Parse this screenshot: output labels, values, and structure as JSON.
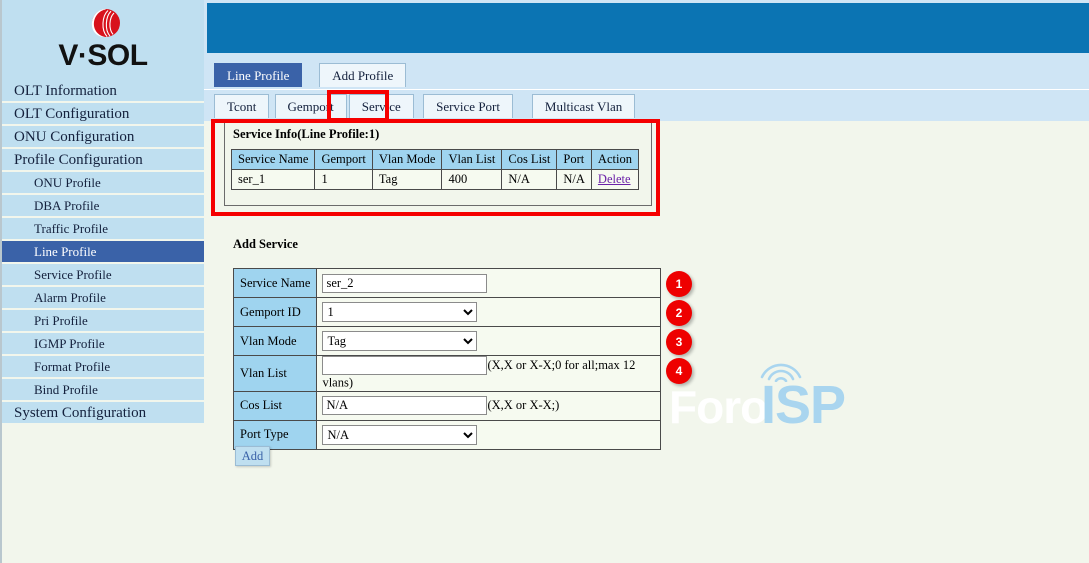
{
  "brand": {
    "logo_text": "V·SOL",
    "logo_mark": "vsol-sphere-icon",
    "logo_color": "#d8121c"
  },
  "sidebar": {
    "items": [
      {
        "label": "OLT Information",
        "level": "top",
        "active": false
      },
      {
        "label": "OLT Configuration",
        "level": "top",
        "active": false
      },
      {
        "label": "ONU Configuration",
        "level": "top",
        "active": false
      },
      {
        "label": "Profile Configuration",
        "level": "top",
        "active": false
      },
      {
        "label": "ONU Profile",
        "level": "sub",
        "active": false
      },
      {
        "label": "DBA Profile",
        "level": "sub",
        "active": false
      },
      {
        "label": "Traffic Profile",
        "level": "sub",
        "active": false
      },
      {
        "label": "Line Profile",
        "level": "sub",
        "active": true
      },
      {
        "label": "Service Profile",
        "level": "sub",
        "active": false
      },
      {
        "label": "Alarm Profile",
        "level": "sub",
        "active": false
      },
      {
        "label": "Pri Profile",
        "level": "sub",
        "active": false
      },
      {
        "label": "IGMP Profile",
        "level": "sub",
        "active": false
      },
      {
        "label": "Format Profile",
        "level": "sub",
        "active": false
      },
      {
        "label": "Bind Profile",
        "level": "sub",
        "active": false
      },
      {
        "label": "System Configuration",
        "level": "top",
        "active": false
      }
    ]
  },
  "header": {
    "bar_color": "#0b74b3"
  },
  "tabs_primary": [
    {
      "label": "Line Profile",
      "selected": true
    },
    {
      "label": "Add Profile",
      "selected": false
    }
  ],
  "tabs_secondary": [
    {
      "label": "Tcont",
      "selected": false
    },
    {
      "label": "Gemport",
      "selected": false
    },
    {
      "label": "Service",
      "selected": true
    },
    {
      "label": "Service Port",
      "selected": false
    },
    {
      "label": "Multicast Vlan",
      "selected": false
    }
  ],
  "service_info": {
    "title": "Service Info(Line Profile:1)",
    "columns": [
      "Service Name",
      "Gemport",
      "Vlan Mode",
      "Vlan List",
      "Cos List",
      "Port",
      "Action"
    ],
    "rows": [
      {
        "service_name": "ser_1",
        "gemport": "1",
        "vlan_mode": "Tag",
        "vlan_list": "400",
        "cos_list": "N/A",
        "port": "N/A",
        "action": "Delete"
      }
    ]
  },
  "add_service": {
    "title": "Add Service",
    "fields": {
      "service_name": {
        "label": "Service Name",
        "value": "ser_2",
        "placeholder": ""
      },
      "gemport_id": {
        "label": "Gemport ID",
        "value": "1"
      },
      "vlan_mode": {
        "label": "Vlan Mode",
        "value": "Tag"
      },
      "vlan_list": {
        "label": "Vlan List",
        "value": "",
        "placeholder": "",
        "hint": "(X,X or X-X;0 for all;max 12 vlans)"
      },
      "cos_list": {
        "label": "Cos List",
        "value": "N/A",
        "hint": "(X,X or X-X;)"
      },
      "port_type": {
        "label": "Port Type",
        "value": "N/A"
      }
    },
    "submit_label": "Add"
  },
  "callouts": {
    "badges": [
      "1",
      "2",
      "3",
      "4"
    ],
    "highlight_color": "#f50000"
  },
  "watermark": {
    "part1": "Foro",
    "part2": "ISP"
  }
}
